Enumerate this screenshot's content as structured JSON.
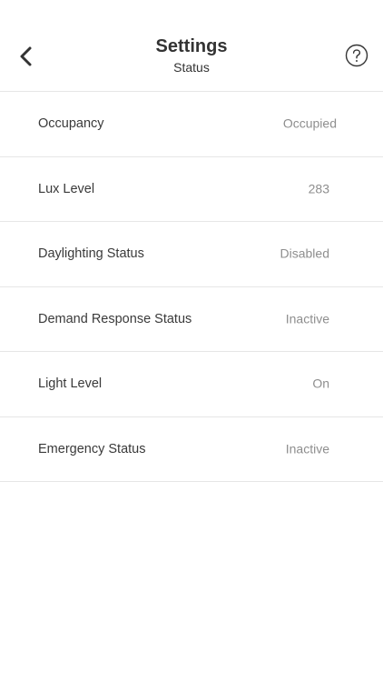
{
  "header": {
    "title": "Settings",
    "subtitle": "Status",
    "back_icon": "chevron-left-icon",
    "help_icon": "question-circle-icon"
  },
  "status_items": [
    {
      "label": "Occupancy",
      "value": "Occupied"
    },
    {
      "label": "Lux Level",
      "value": "283"
    },
    {
      "label": "Daylighting Status",
      "value": "Disabled"
    },
    {
      "label": "Demand Response Status",
      "value": "Inactive"
    },
    {
      "label": "Light Level",
      "value": "On"
    },
    {
      "label": "Emergency Status",
      "value": "Inactive"
    }
  ],
  "colors": {
    "text": "#333333",
    "value_text": "#8e8e8e",
    "divider": "#e6e6e6",
    "background": "#ffffff"
  }
}
